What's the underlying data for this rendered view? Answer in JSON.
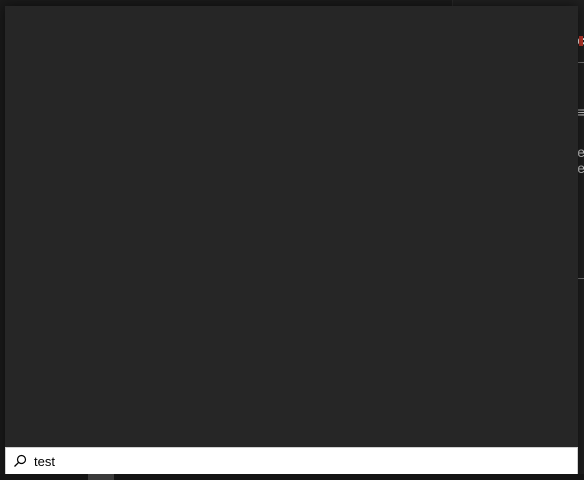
{
  "background_window": {
    "fragment_top": "'c",
    "fragment_menu": "≡",
    "fragment_line1": "e",
    "fragment_line2": "e"
  },
  "search": {
    "value": "test",
    "icon": "search-icon"
  },
  "colors": {
    "flyout_background": "#262626",
    "search_box_background": "#ffffff",
    "accent": "#c0392b"
  }
}
